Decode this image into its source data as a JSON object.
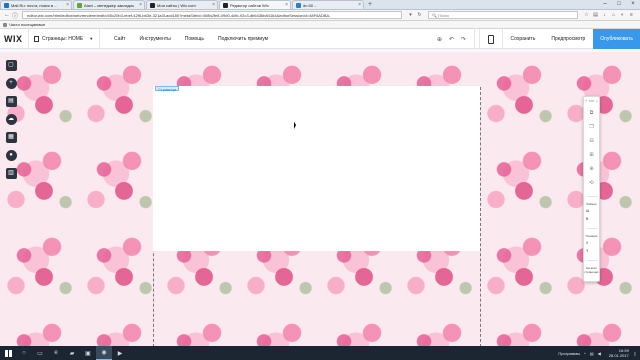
{
  "browser": {
    "tabs": [
      {
        "label": "Mail.Ru: почта, поиск в ...",
        "color": "#1a73c7",
        "active": false
      },
      {
        "label": "Atavi – менеджер закладок",
        "color": "#5aaa37",
        "active": false
      },
      {
        "label": "Мои сайты | Wix.com",
        "color": "#222222",
        "active": false
      },
      {
        "label": "Редактор сайтов Wix",
        "color": "#222222",
        "active": true
      },
      {
        "label": "dn 60 ...",
        "color": "#2b81c8",
        "active": false
      }
    ],
    "url": "editor.wix.com/html/editor/web/renderer/edit/c55c20b3-ebef-42f6-b63e-321a31acd180?metaSiteId=408b2fe8-09d0-4dfc-92c3-db6436b84164&editorSessionId=48F6ADBA-",
    "search_placeholder": "Поиск",
    "bookmarks": [
      "Часто посещаемые"
    ]
  },
  "wix": {
    "logo": "WIX",
    "page_selector": "Страницы: HOME",
    "menu": [
      "Сайт",
      "Инструменты",
      "Помощь",
      "Подключить премиум"
    ],
    "save": "Сохранить",
    "preview": "Предпросмотр",
    "publish": "Опубликовать"
  },
  "canvas": {
    "page_tag": "Страница"
  },
  "inspector": {
    "top": [
      "?",
      "100",
      "×"
    ],
    "size_label": "Размер",
    "w_label": "Ш",
    "h_label": "В",
    "position_label": "Позиция",
    "x_label": "X",
    "y_label": "Y",
    "all_pages_label": "На всех страницах"
  },
  "taskbar": {
    "lang": "Программы",
    "time": "16:59",
    "date": "28.01.2017"
  },
  "colors": {
    "wix_blue": "#3899ec",
    "rail_dark": "#2b3440",
    "taskbar": "#1c2633"
  }
}
